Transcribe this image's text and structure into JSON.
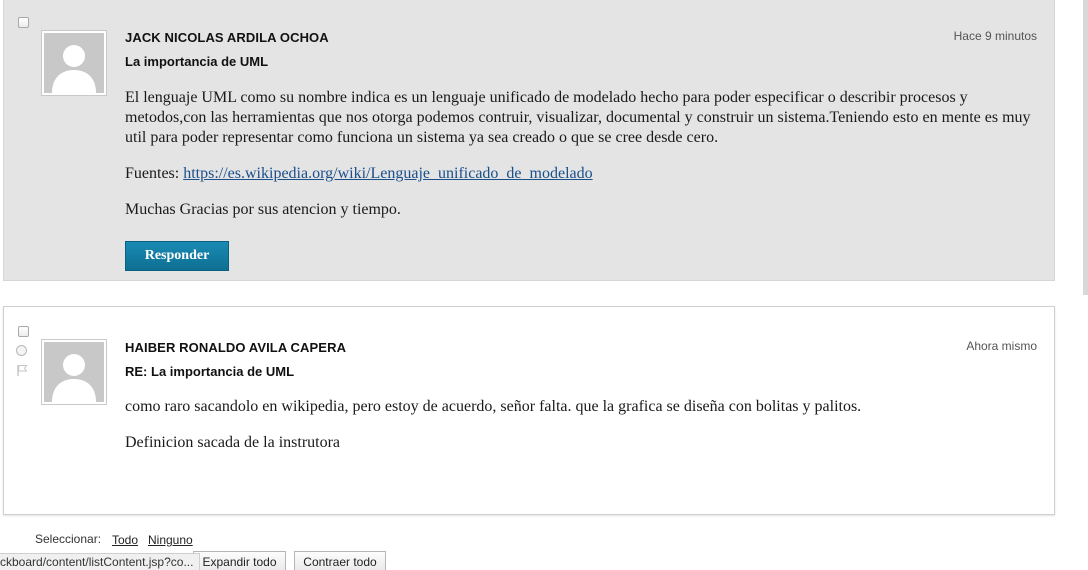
{
  "posts": [
    {
      "author": "JACK NICOLAS ARDILA OCHOA",
      "time": "Hace 9 minutos",
      "subject": "La importancia de UML",
      "body": [
        "El lenguaje UML como su nombre indica es un lenguaje unificado de modelado hecho para poder especificar o describir procesos y metodos,con las herramientas que nos otorga podemos contruir, visualizar, documental y construir un sistema.Teniendo esto en mente es muy util para poder representar como funciona un sistema ya sea creado o que se cree desde cero."
      ],
      "sources_label": "Fuentes:",
      "sources_link": "https://es.wikipedia.org/wiki/Lenguaje_unificado_de_modelado",
      "closing": "Muchas Gracias por sus atencion y tiempo.",
      "reply_label": "Responder"
    },
    {
      "author": "HAIBER RONALDO AVILA CAPERA",
      "time": "Ahora mismo",
      "subject": "RE: La importancia de UML",
      "body": [
        "como raro sacandolo en wikipedia, pero estoy de acuerdo, señor falta. que la grafica se diseña con bolitas y palitos.",
        "Definicion sacada de la instrutora"
      ]
    }
  ],
  "footer": {
    "select_label": "Seleccionar:",
    "select_all": "Todo",
    "select_none": "Ninguno",
    "expand_all": "Expandir todo",
    "collapse_all": "Contraer todo"
  },
  "status_bar": {
    "url": "ckboard/content/listContent.jsp?co..."
  },
  "colors": {
    "selected_post_bg": "#e4e4e4",
    "reply_button": "#1a8bb3",
    "link": "#1a4f8a"
  }
}
